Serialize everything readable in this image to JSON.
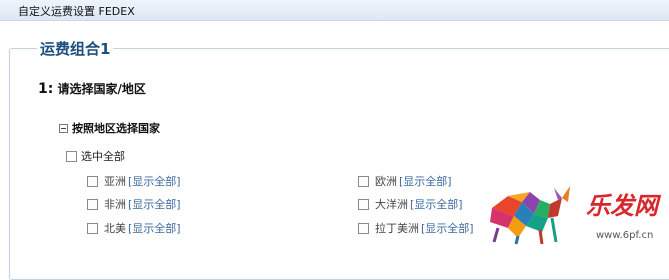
{
  "window": {
    "title": "自定义运费设置 FEDEX"
  },
  "group": {
    "legend": "运费组合1"
  },
  "step": {
    "number": "1:",
    "text": "请选择国家/地区"
  },
  "tree": {
    "by_region_label": "按照地区选择国家",
    "select_all_label": "选中全部",
    "show_all_label": "[显示全部]",
    "regions_left": [
      "亚洲",
      "非洲",
      "北美"
    ],
    "regions_right": [
      "欧洲",
      "大洋洲",
      "拉丁美洲"
    ]
  },
  "watermark": {
    "brand": "乐发网",
    "site": "www.6pf.cn"
  }
}
